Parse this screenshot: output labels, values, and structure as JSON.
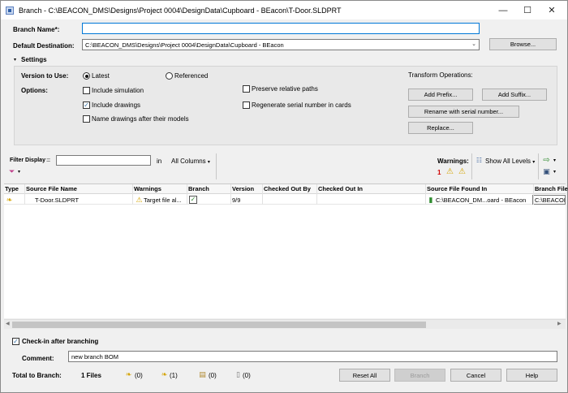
{
  "window": {
    "title": "Branch - C:\\BEACON_DMS\\Designs\\Project 0004\\DesignData\\Cupboard - BEacon\\T-Door.SLDPRT",
    "minimize": "—",
    "maximize": "☐",
    "close": "✕"
  },
  "branch_name": {
    "label": "Branch Name*:",
    "value": ""
  },
  "default_destination": {
    "label": "Default Destination:",
    "value": "C:\\BEACON_DMS\\Designs\\Project 0004\\DesignData\\Cupboard - BEacon",
    "browse_label": "Browse..."
  },
  "settings": {
    "header": "Settings",
    "version_label": "Version to Use:",
    "version_options": [
      {
        "label": "Latest",
        "selected": true
      },
      {
        "label": "Referenced",
        "selected": false
      }
    ],
    "options_label": "Options:",
    "options": [
      {
        "label": "Include simulation",
        "checked": false
      },
      {
        "label": "Include drawings",
        "checked": true
      },
      {
        "label": "Name drawings after their models",
        "checked": false
      },
      {
        "label": "Preserve relative paths",
        "checked": false
      },
      {
        "label": "Regenerate serial number in cards",
        "checked": false
      }
    ],
    "transform_label": "Transform Operations:",
    "transform_buttons": {
      "add_prefix": "Add Prefix...",
      "add_suffix": "Add Suffix...",
      "rename_serial": "Rename with serial number...",
      "replace": "Replace..."
    }
  },
  "filter": {
    "label": "Filter Display",
    "value": "",
    "in_label": "in",
    "columns_label": "All Columns"
  },
  "warnings_bar": {
    "label": "Warnings:",
    "count": "1",
    "levels_label": "Show All Levels"
  },
  "grid": {
    "columns": [
      "Type",
      "Source File Name",
      "Warnings",
      "Branch",
      "Version",
      "Checked Out By",
      "Checked Out In",
      "Source File Found In",
      "Branch File"
    ],
    "rows": [
      {
        "source_file_name": "T-Door.SLDPRT",
        "warnings": "Target file al...",
        "branch_checked": true,
        "version": "9/9",
        "checked_out_by": "",
        "checked_out_in": "",
        "found_in": "C:\\BEACON_DM...oard - BEacon",
        "branch_file": "C:\\BEACON"
      }
    ]
  },
  "checkin": {
    "label": "Check-in after branching",
    "checked": true,
    "comment_label": "Comment:",
    "comment_value": "new branch BOM"
  },
  "totals": {
    "label": "Total to Branch:",
    "files": "1 Files",
    "c1": "(0)",
    "c2": "(1)",
    "c3": "(0)",
    "c4": "(0)"
  },
  "footer": {
    "reset": "Reset All",
    "branch": "Branch",
    "cancel": "Cancel",
    "help": "Help"
  },
  "colors": {
    "accent": "#0078d7",
    "warning": "#e6b800",
    "check_green": "#2e8b2e"
  }
}
